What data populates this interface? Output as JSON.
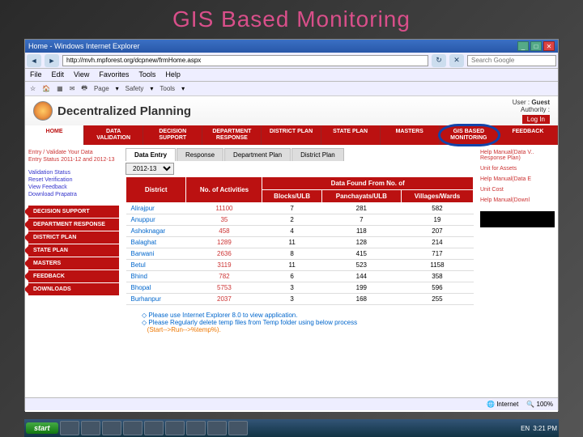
{
  "slide": {
    "title": "GIS Based Monitoring"
  },
  "window": {
    "title": "Home - Windows Internet Explorer"
  },
  "nav": {
    "url": "http://mvh.mpforest.org/dcpnew/frmHome.aspx",
    "search_ph": "Search Google"
  },
  "menu": {
    "file": "File",
    "edit": "Edit",
    "view": "View",
    "favorites": "Favorites",
    "tools": "Tools",
    "help": "Help"
  },
  "toolbar": {
    "home": "Home",
    "page": "Page",
    "safety": "Safety",
    "tools": "Tools"
  },
  "header": {
    "site": "Decentralized Planning",
    "user_lbl": "User :",
    "user": "Guest",
    "auth_lbl": "Authority :",
    "login": "Log In"
  },
  "mainnav": {
    "home": "HOME",
    "data": "DATA VALIDATION",
    "decision": "DECISION SUPPORT",
    "dept": "DEPARTMENT RESPONSE",
    "district": "DISTRICT PLAN",
    "state": "STATE PLAN",
    "masters": "MASTERS",
    "gis": "GIS BASED MONITORING",
    "feedback": "FEEDBACK"
  },
  "leftlinks": {
    "l1": "Entry / Validate Your Data",
    "l2": "Entry Status 2011-12 and 2012-13",
    "l3": "Validation Status",
    "l4": "Reset Verification",
    "l5": "View Feedback",
    "l6": "Download Prapatra"
  },
  "sidenav": {
    "s1": "DECISION SUPPORT",
    "s2": "DEPARTMENT RESPONSE",
    "s3": "DISTRICT PLAN",
    "s4": "STATE PLAN",
    "s5": "MASTERS",
    "s6": "FEEDBACK",
    "s7": "DOWNLOADS"
  },
  "tabs": {
    "t1": "Data Entry",
    "t2": "Response",
    "t3": "Department Plan",
    "t4": "District Plan"
  },
  "year": "2012-13",
  "table": {
    "h1": "District",
    "h2": "No. of Activities",
    "h3": "Data Found From No. of",
    "h3a": "Blocks/ULB",
    "h3b": "Panchayats/ULB",
    "h3c": "Villages/Wards",
    "rows": [
      {
        "d": "Alirajpur",
        "a": "11100",
        "b": "7",
        "p": "281",
        "v": "582"
      },
      {
        "d": "Anuppur",
        "a": "35",
        "b": "2",
        "p": "7",
        "v": "19"
      },
      {
        "d": "Ashoknagar",
        "a": "458",
        "b": "4",
        "p": "118",
        "v": "207"
      },
      {
        "d": "Balaghat",
        "a": "1289",
        "b": "11",
        "p": "128",
        "v": "214"
      },
      {
        "d": "Barwani",
        "a": "2636",
        "b": "8",
        "p": "415",
        "v": "717"
      },
      {
        "d": "Betul",
        "a": "3119",
        "b": "11",
        "p": "523",
        "v": "1158"
      },
      {
        "d": "Bhind",
        "a": "782",
        "b": "6",
        "p": "144",
        "v": "358"
      },
      {
        "d": "Bhopal",
        "a": "5753",
        "b": "3",
        "p": "199",
        "v": "596"
      },
      {
        "d": "Burhanpur",
        "a": "2037",
        "b": "3",
        "p": "168",
        "v": "255"
      }
    ]
  },
  "notes": {
    "n1": "Please use Internet Explorer 8.0 to view application.",
    "n2": "Please Regularly delete temp files from Temp folder using below process",
    "n3": "(Start-->Run-->%temp%)."
  },
  "rightlinks": {
    "r1": "Help Manual(Data V.. Response Plan)",
    "r2": "Unit for Assets",
    "r3": "Help Manual(Data E",
    "r4": "Unit Cost",
    "r5": "Help Manual(Downl"
  },
  "status": {
    "internet": "Internet",
    "zoom": "100%"
  },
  "taskbar": {
    "start": "start",
    "time": "3:21 PM"
  }
}
